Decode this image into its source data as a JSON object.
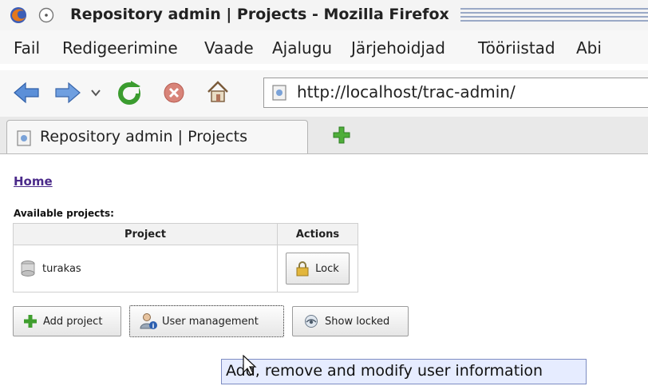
{
  "window": {
    "title": "Repository admin | Projects - Mozilla Firefox"
  },
  "menu": [
    "Fail",
    "Redigeerimine",
    "Vaade",
    "Ajalugu",
    "Järjehoidjad",
    "Tööriistad",
    "Abi"
  ],
  "navigation": {
    "url": "http://localhost/trac-admin/"
  },
  "tabs": [
    {
      "label": "Repository admin | Projects"
    }
  ],
  "page": {
    "home_link": "Home",
    "projects_heading": "Available projects:",
    "table": {
      "headers": [
        "Project",
        "Actions"
      ],
      "rows": [
        {
          "name": "turakas",
          "action": "Lock"
        }
      ]
    },
    "buttons": {
      "add_project": "Add project",
      "user_management": "User management",
      "show_locked": "Show locked"
    }
  },
  "tooltip": {
    "text": "Add, remove and modify user information"
  }
}
